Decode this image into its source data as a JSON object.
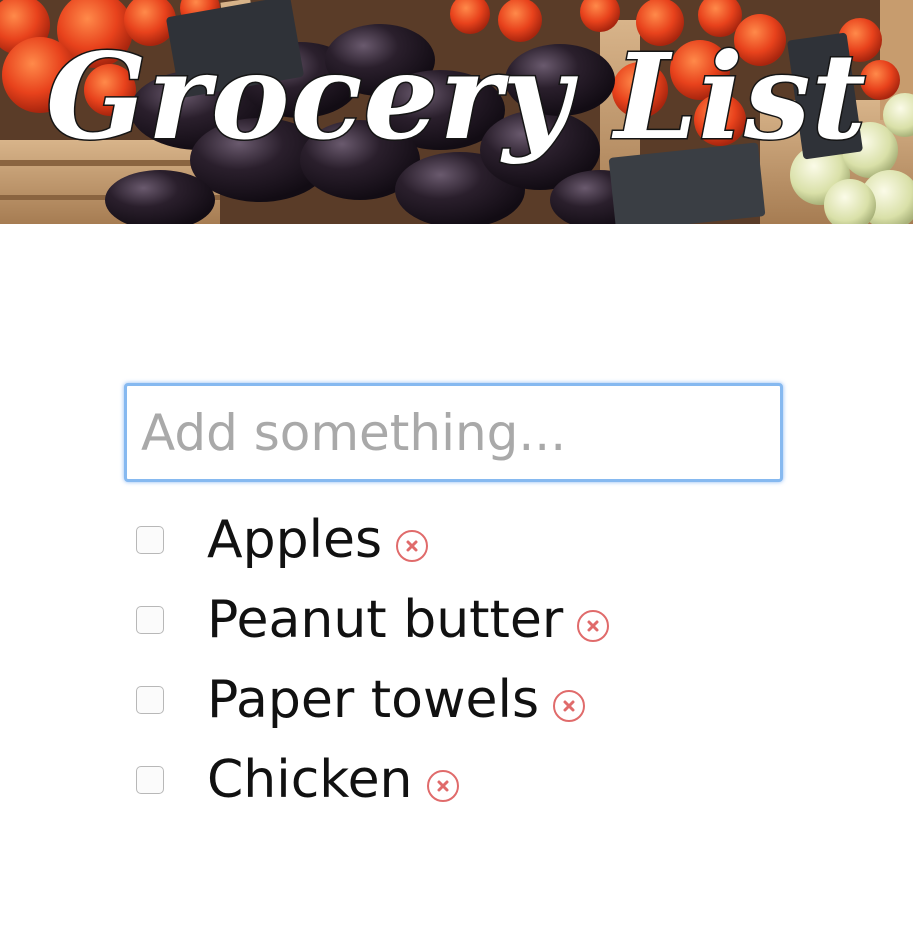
{
  "header": {
    "title": "Grocery List"
  },
  "input": {
    "placeholder": "Add something..."
  },
  "list": {
    "items": [
      {
        "label": "Apples",
        "checked": false
      },
      {
        "label": "Peanut butter",
        "checked": false
      },
      {
        "label": "Paper towels",
        "checked": false
      },
      {
        "label": "Chicken",
        "checked": false
      }
    ]
  },
  "colors": {
    "input_focus_border": "#86b9f0",
    "remove_icon": "#e06b6b",
    "placeholder": "#a9a9a9"
  },
  "icons": {
    "remove": "close-circle-icon"
  }
}
